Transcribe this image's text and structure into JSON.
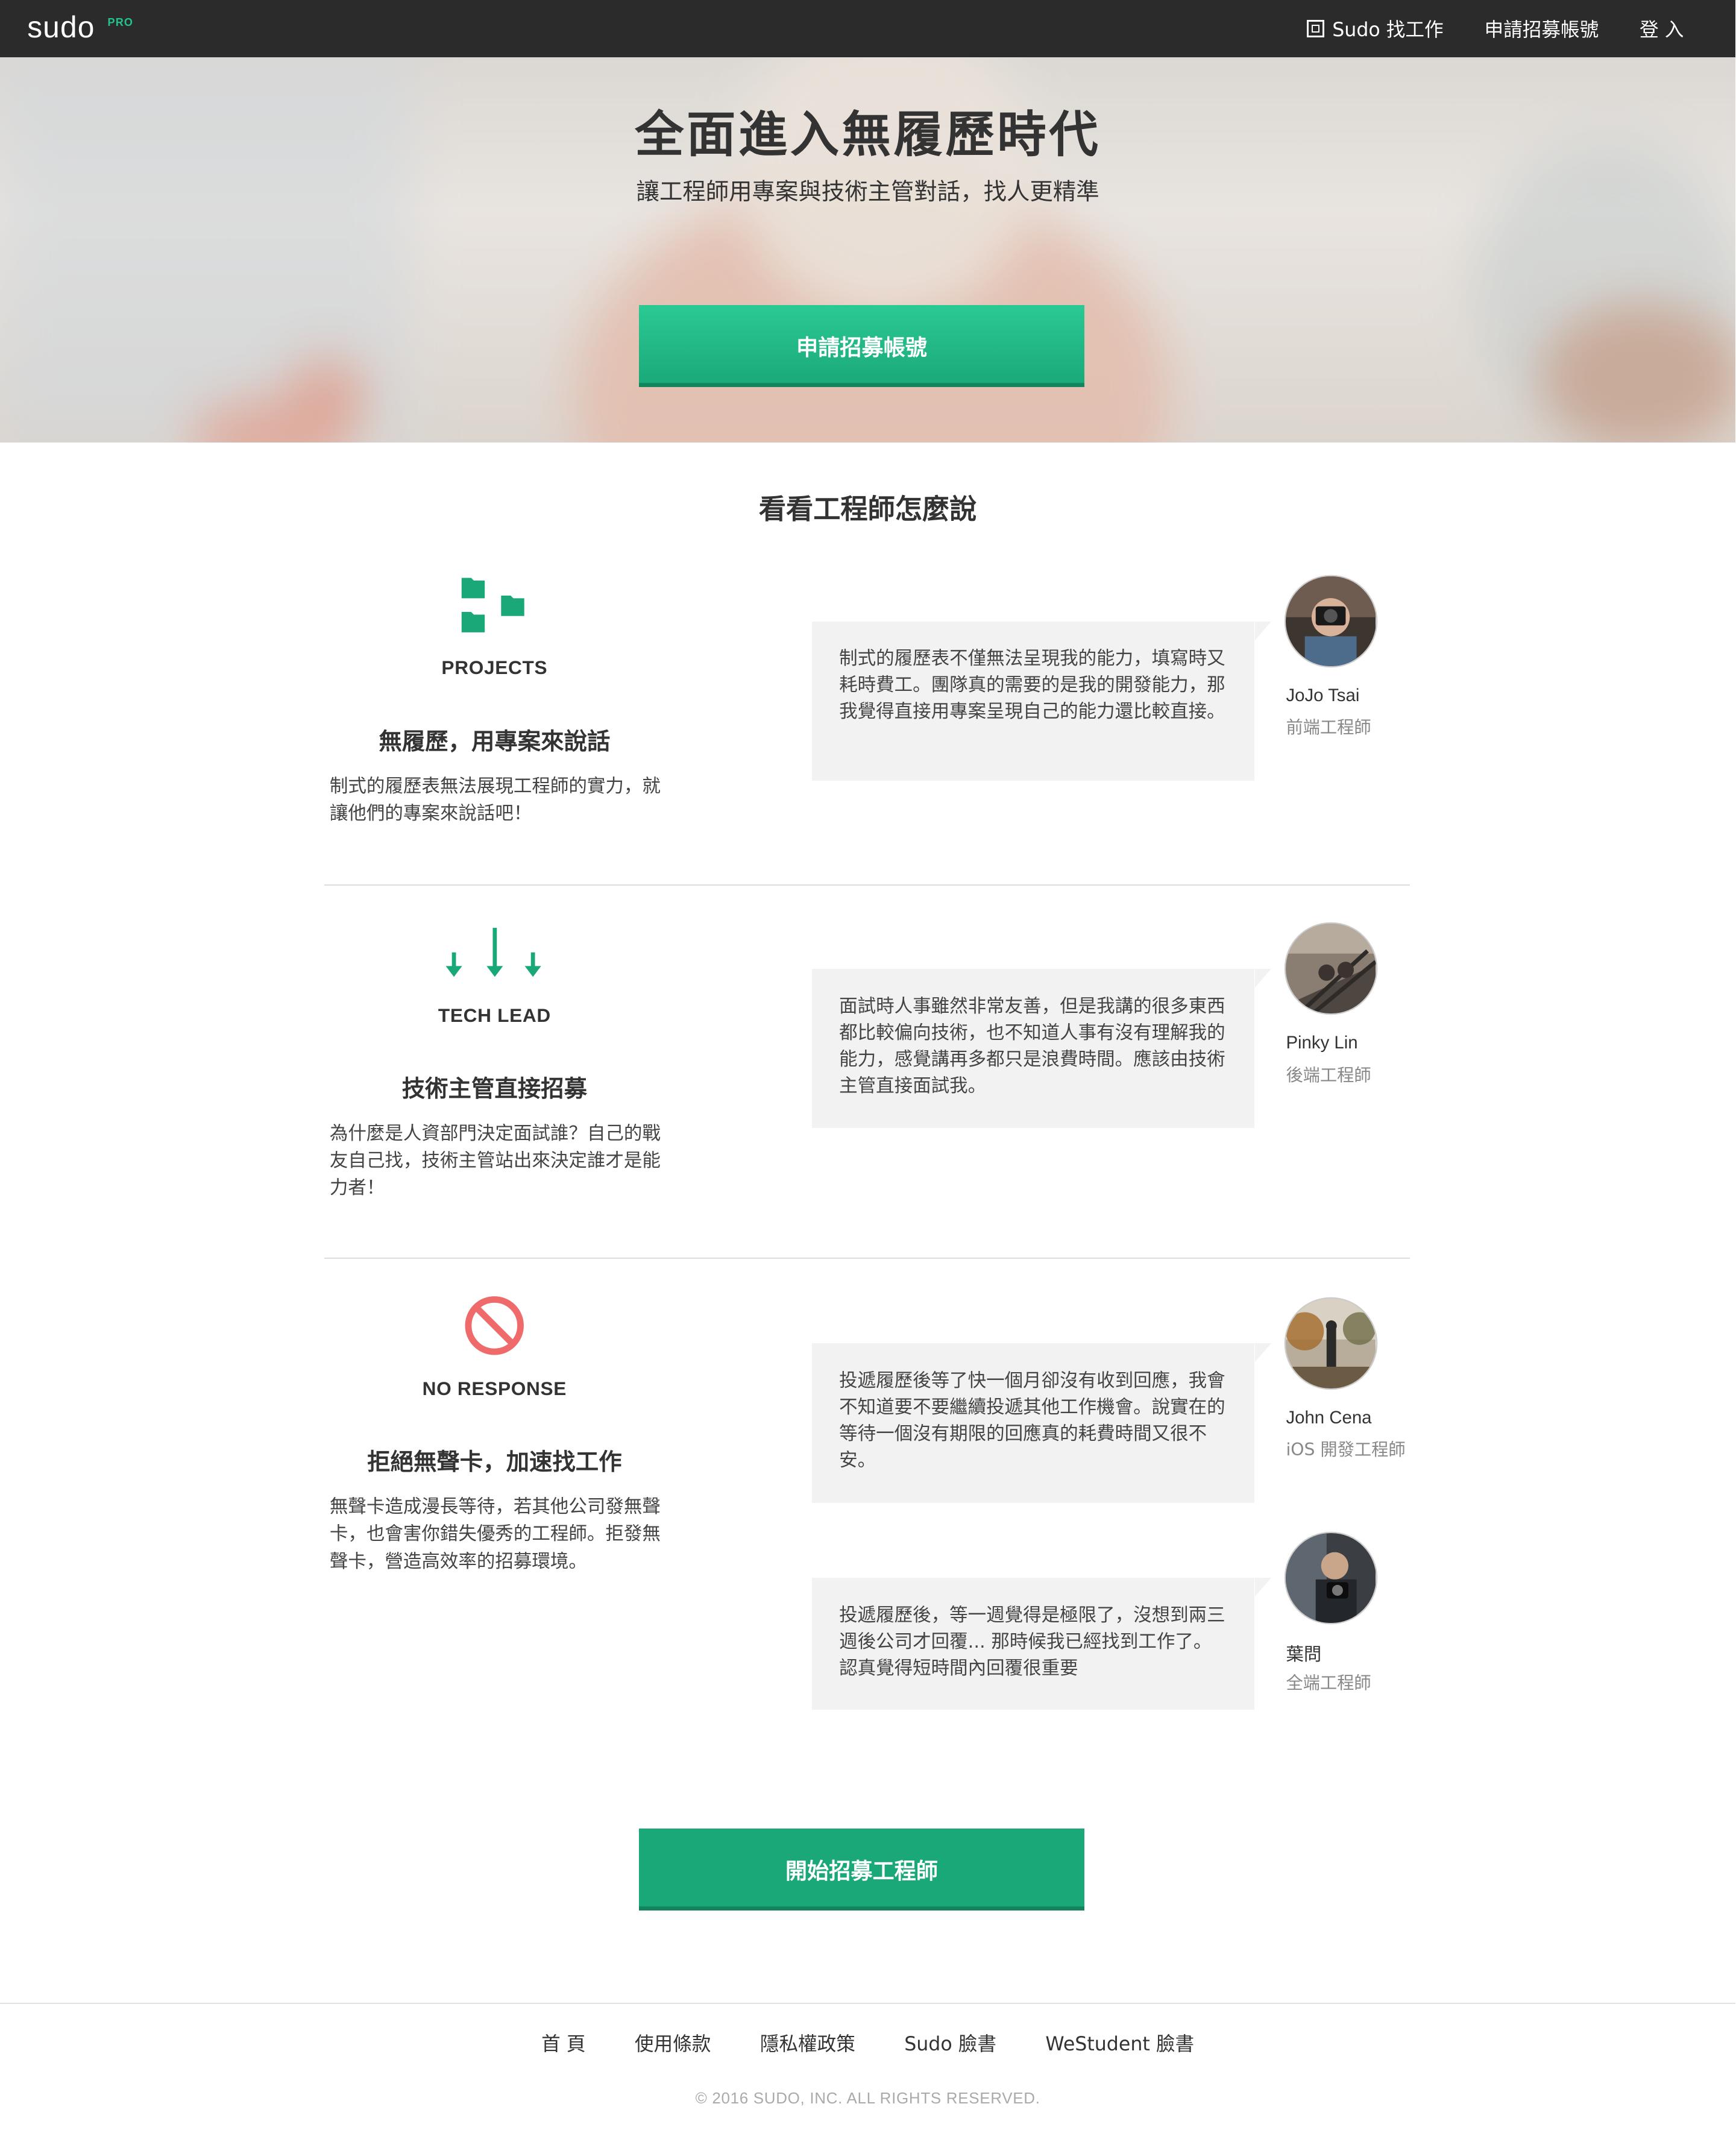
{
  "nav": {
    "logo": "sudo",
    "logo_badge": "PRO",
    "links": [
      {
        "label": "Sudo 找工作",
        "icon": "back-icon"
      },
      {
        "label": "申請招募帳號"
      },
      {
        "label": "登 入"
      }
    ]
  },
  "hero": {
    "title": "全面進入無履歷時代",
    "subtitle": "讓工程師用專案與技術主管對話，找人更精準",
    "cta": "申請招募帳號"
  },
  "section": {
    "title": "看看工程師怎麼說"
  },
  "features": [
    {
      "icon": "folders-icon",
      "caps": "PROJECTS",
      "heading": "無履歷，用專案來說話",
      "desc": "制式的履歷表無法展現工程師的實力，就讓他們的專案來說話吧！"
    },
    {
      "icon": "arrows-down-icon",
      "caps": "TECH LEAD",
      "heading": "技術主管直接招募",
      "desc": "為什麼是人資部門決定面試誰？自己的戰友自己找，技術主管站出來決定誰才是能力者！"
    },
    {
      "icon": "prohibited-icon",
      "caps": "NO RESPONSE",
      "heading": "拒絕無聲卡，加速找工作",
      "desc": "無聲卡造成漫長等待，若其他公司發無聲卡，也會害你錯失優秀的工程師。拒發無聲卡，營造高效率的招募環境。"
    }
  ],
  "testimonials": [
    {
      "quote": "制式的履歷表不僅無法呈現我的能力，填寫時又耗時費工。團隊真的需要的是我的開發能力，那我覺得直接用專案呈現自己的能力還比較直接。",
      "name": "JoJo Tsai",
      "role": "前端工程師"
    },
    {
      "quote": "面試時人事雖然非常友善，但是我講的很多東西都比較偏向技術，也不知道人事有沒有理解我的能力，感覺講再多都只是浪費時間。應該由技術主管直接面試我。",
      "name": "Pinky Lin",
      "role": "後端工程師"
    },
    {
      "quote": "投遞履歷後等了快一個月卻沒有收到回應，我會不知道要不要繼續投遞其他工作機會。說實在的等待一個沒有期限的回應真的耗費時間又很不安。",
      "name": "John Cena",
      "role": "iOS 開發工程師"
    },
    {
      "quote": "投遞履歷後，等一週覺得是極限了，沒想到兩三週後公司才回覆... 那時候我已經找到工作了。認真覺得短時間內回覆很重要",
      "name": "葉問",
      "role": "全端工程師"
    }
  ],
  "bottom_cta": "開始招募工程師",
  "footer": {
    "links": [
      "首 頁",
      "使用條款",
      "隱私權政策",
      "Sudo 臉書",
      "WeStudent 臉書"
    ],
    "copyright": "© 2016 SUDO, INC. ALL RIGHTS RESERVED."
  },
  "colors": {
    "nav_bg": "#2b2b2b",
    "accent": "#1aa878",
    "icon_green": "#1aa878",
    "prohibited_red": "#ef6b6b",
    "bubble_bg": "#f2f2f2"
  }
}
